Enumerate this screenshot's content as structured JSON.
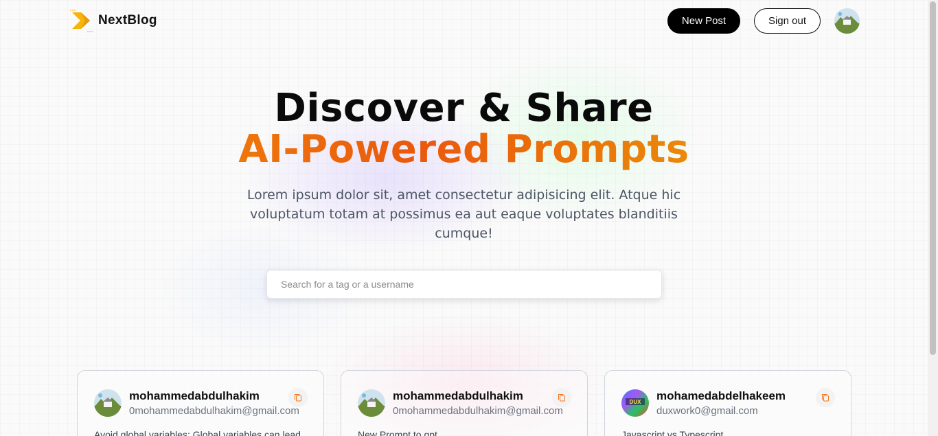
{
  "nav": {
    "brand": "NextBlog",
    "new_post_label": "New Post",
    "sign_out_label": "Sign out",
    "accent_color": "#f59e0b"
  },
  "hero": {
    "title_line1": "Discover & Share",
    "title_line2": "AI-Powered Prompts",
    "description": "Lorem ipsum dolor sit, amet consectetur adipisicing elit. Atque hic voluptatum totam at possimus ea aut eaque voluptates blanditiis cumque!",
    "gradient_colors": [
      "#f59e0b",
      "#ea580c",
      "#eab308"
    ]
  },
  "search": {
    "placeholder": "Search for a tag or a username",
    "value": ""
  },
  "posts": [
    {
      "username": "mohammedabdulhakim",
      "email": "0mohammedabdulhakim@gmail.com",
      "prompt": "Avoid global variables: Global variables can lead",
      "avatar_icon": "landscape-avatar-icon"
    },
    {
      "username": "mohammedabdulhakim",
      "email": "0mohammedabdulhakim@gmail.com",
      "prompt": "New Prompt to gpt",
      "avatar_icon": "landscape-avatar-icon"
    },
    {
      "username": "mohamedabdelhakeem",
      "email": "duxwork0@gmail.com",
      "prompt": "Javascript vs Typescript",
      "avatar_icon": "dux-logo-avatar-icon"
    }
  ],
  "copy_icon": "copy-icon"
}
